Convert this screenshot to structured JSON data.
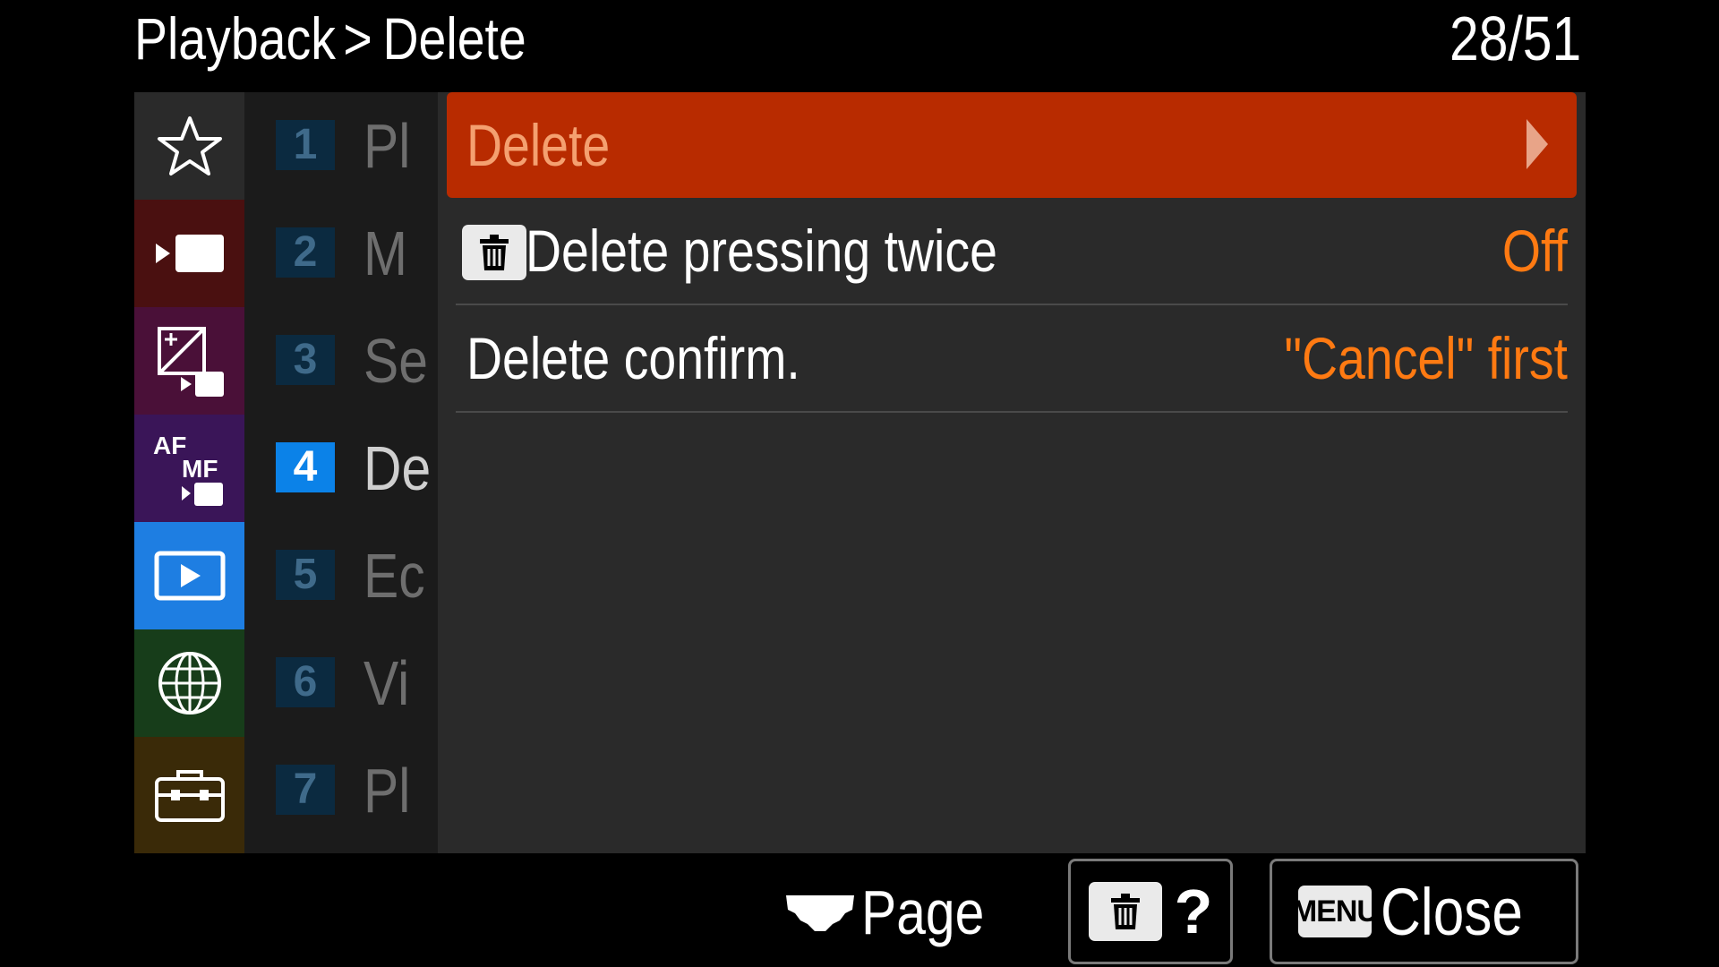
{
  "header": {
    "breadcrumb_parent": "Playback",
    "breadcrumb_separator": ">",
    "breadcrumb_current": "Delete",
    "page_counter": "28/51"
  },
  "categories": [
    {
      "icon": "star-icon",
      "color": "#2a2a2a",
      "selected": false
    },
    {
      "icon": "movie-camera-icon",
      "color": "#4a1010",
      "selected": false
    },
    {
      "icon": "exposure-color-icon",
      "color": "#4a1038",
      "selected": false
    },
    {
      "icon": "af-mf-icon",
      "color": "#3a1558",
      "selected": false
    },
    {
      "icon": "playback-icon",
      "color": "#1e7ee2",
      "selected": true
    },
    {
      "icon": "network-globe-icon",
      "color": "#173d1a",
      "selected": false
    },
    {
      "icon": "setup-toolbox-icon",
      "color": "#3a2a08",
      "selected": false
    }
  ],
  "pages": [
    {
      "number": "1",
      "label": "Pl"
    },
    {
      "number": "2",
      "label": "M"
    },
    {
      "number": "3",
      "label": "Se"
    },
    {
      "number": "4",
      "label": "De"
    },
    {
      "number": "5",
      "label": "Ec"
    },
    {
      "number": "6",
      "label": "Vi"
    },
    {
      "number": "7",
      "label": "Pl"
    }
  ],
  "active_page": "4",
  "menu_items": [
    {
      "label": "Delete",
      "value": "",
      "selected": true,
      "icon": "chevron-right-icon"
    },
    {
      "label": "Delete pressing twice",
      "value": "Off",
      "selected": false,
      "icon": "trash-icon"
    },
    {
      "label": "Delete confirm.",
      "value": "\"Cancel\" first",
      "selected": false,
      "icon": ""
    }
  ],
  "footer": {
    "page_label": "Page",
    "help_label": "?",
    "menu_badge": "MENU",
    "close_label": "Close"
  },
  "colors": {
    "selected_row": "#b82b00",
    "value_text": "#ff7a12",
    "active_category": "#1e7ee2",
    "active_page_number": "#0b82e8"
  }
}
